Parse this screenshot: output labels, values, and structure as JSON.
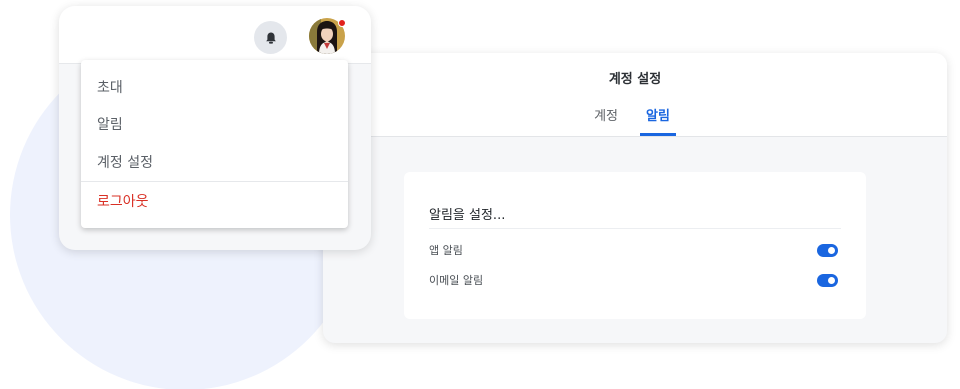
{
  "settings": {
    "title": "계정 설정",
    "tabs": [
      {
        "label": "계정",
        "active": false
      },
      {
        "label": "알림",
        "active": true
      }
    ],
    "card": {
      "heading": "알림을 설정...",
      "rows": [
        {
          "label": "앱 알림",
          "enabled": true
        },
        {
          "label": "이메일 알림",
          "enabled": true
        }
      ]
    }
  },
  "header": {
    "bell_icon": "bell-icon",
    "avatar_status": "online-notification-dot"
  },
  "menu": {
    "items": [
      {
        "label": "초대"
      },
      {
        "label": "알림"
      },
      {
        "label": "계정 설정"
      },
      {
        "label": "로그아웃"
      }
    ]
  },
  "colors": {
    "accent": "#1a66e0",
    "danger": "#d93025",
    "background_circle": "#eef2fd",
    "panel": "#f6f7f9"
  }
}
